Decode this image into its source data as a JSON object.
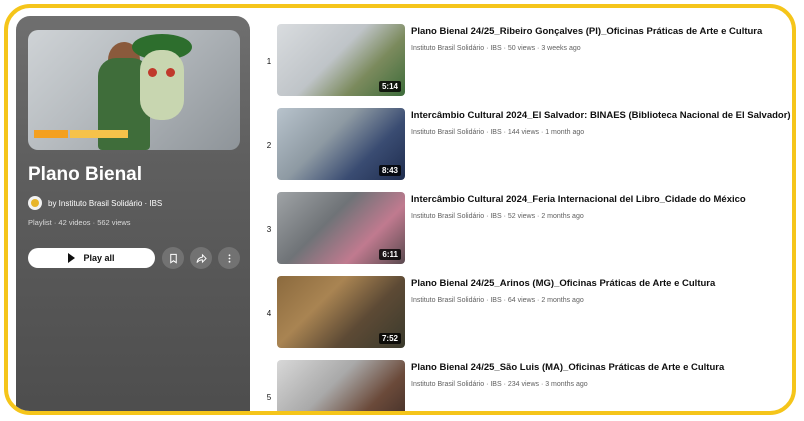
{
  "playlist": {
    "title": "Plano Bienal",
    "owner": "by Instituto Brasil Solidário · IBS",
    "meta": "Playlist · 42 videos · 562 views",
    "play_all_label": "Play all",
    "frame_color": "#f5c51a"
  },
  "icons": {
    "save": "bookmark-icon",
    "share": "share-icon",
    "more": "more-vertical-icon"
  },
  "videos": [
    {
      "index": "1",
      "title": "Plano Bienal 24/25_Ribeiro Gonçalves (PI)_Oficinas Práticas de Arte e Cultura",
      "subtitle": "Instituto Brasil Solidário · IBS · 50 views · 3 weeks ago",
      "duration": "5:14"
    },
    {
      "index": "2",
      "title": "Intercâmbio Cultural 2024_El Salvador: BINAES (Biblioteca Nacional de El Salvador)",
      "subtitle": "Instituto Brasil Solidário · IBS · 144 views · 1 month ago",
      "duration": "8:43"
    },
    {
      "index": "3",
      "title": "Intercâmbio Cultural 2024_Feria Internacional del Libro_Cidade do México",
      "subtitle": "Instituto Brasil Solidário · IBS · 52 views · 2 months ago",
      "duration": "6:11"
    },
    {
      "index": "4",
      "title": "Plano Bienal 24/25_Arinos (MG)_Oficinas Práticas de Arte e Cultura",
      "subtitle": "Instituto Brasil Solidário · IBS · 64 views · 2 months ago",
      "duration": "7:52"
    },
    {
      "index": "5",
      "title": "Plano Bienal 24/25_São Luis (MA)_Oficinas Práticas de Arte e Cultura",
      "subtitle": "Instituto Brasil Solidário · IBS · 234 views · 3 months ago",
      "duration": ""
    }
  ]
}
